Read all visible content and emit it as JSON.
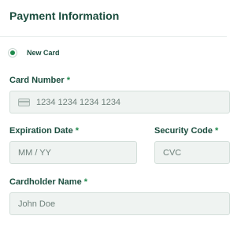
{
  "header": {
    "title": "Payment Information"
  },
  "payment_method": {
    "selected_label": "New Card"
  },
  "card_number": {
    "label": "Card Number",
    "required_mark": "*",
    "placeholder": "1234 1234 1234 1234",
    "icon": "credit-card-icon"
  },
  "expiration_date": {
    "label": "Expiration Date",
    "required_mark": "*",
    "placeholder": "MM / YY"
  },
  "security_code": {
    "label": "Security Code",
    "required_mark": "*",
    "placeholder": "CVC"
  },
  "cardholder_name": {
    "label": "Cardholder Name",
    "required_mark": "*",
    "placeholder": "John Doe"
  },
  "colors": {
    "brand": "#1b4d3e",
    "accent": "#1f8a4c",
    "field_bg": "#eff3f1"
  }
}
